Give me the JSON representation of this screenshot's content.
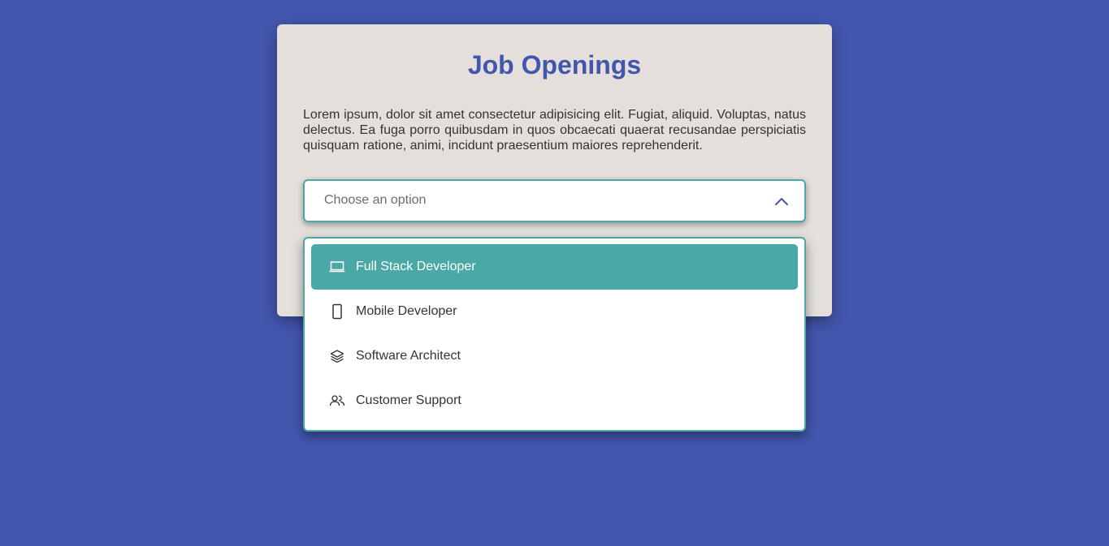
{
  "card": {
    "title": "Job Openings",
    "description": "Lorem ipsum, dolor sit amet consectetur adipisicing elit. Fugiat, aliquid. Voluptas, natus delectus. Ea fuga porro quibusdam in quos obcaecati quaerat recusandae perspiciatis quisquam ratione, animi, incidunt praesentium maiores reprehenderit."
  },
  "select": {
    "placeholder": "Choose an option",
    "icon": "chevron-up-icon",
    "expanded": true
  },
  "options": [
    {
      "label": "Full Stack Developer",
      "icon": "laptop-icon",
      "highlighted": true
    },
    {
      "label": "Mobile Developer",
      "icon": "smartphone-icon",
      "highlighted": false
    },
    {
      "label": "Software Architect",
      "icon": "layers-icon",
      "highlighted": false
    },
    {
      "label": "Customer Support",
      "icon": "users-icon",
      "highlighted": false
    }
  ],
  "colors": {
    "background": "#4356ae",
    "card": "#e4dfdb",
    "accent": "#4aa9a6",
    "title": "#4356ae"
  }
}
